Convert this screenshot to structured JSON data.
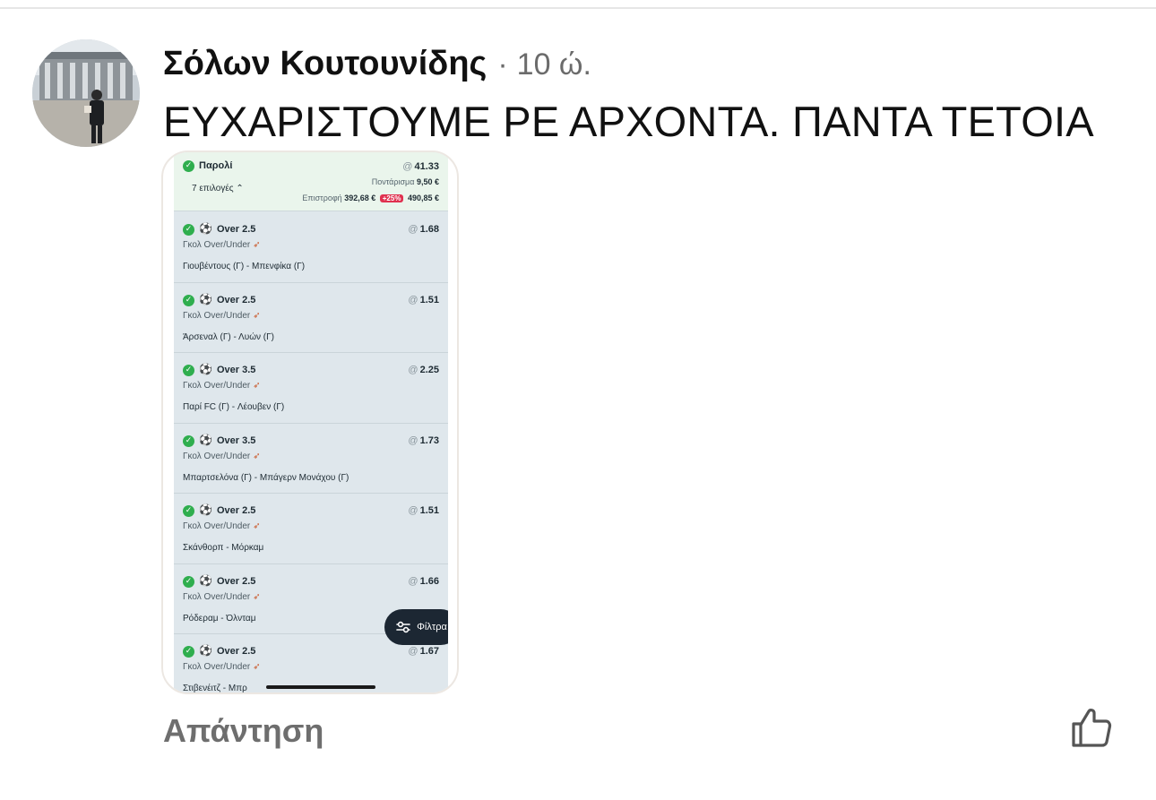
{
  "comment": {
    "author": "Σόλων Κουτουνίδης",
    "separator": "·",
    "time": "10 ώ.",
    "text": "ΕΥΧΑΡΙΣΤΟΥΜΕ ΡΕ ΑΡΧΟΝΤΑ. ΠΑΝΤΑ ΤΕΤΟΙΑ",
    "avatar_icon": "profile-photo"
  },
  "attachment": {
    "summary": {
      "bet_type": "Παρολί",
      "odds_prefix": "@",
      "total_odds": "41.33",
      "selections_label": "7 επιλογές",
      "stake_label": "Ποντάρισμα",
      "stake_value": "9,50 €",
      "return_label": "Επιστροφή",
      "return_value": "392,68 €",
      "boost_label": "+25%",
      "boosted_return": "490,85 €"
    },
    "legs": [
      {
        "pick": "Over 2.5",
        "market": "Γκολ Over/Under",
        "match": "Γιουβέντους (Γ) - Μπενφίκα (Γ)",
        "odds": "1.68"
      },
      {
        "pick": "Over 2.5",
        "market": "Γκολ Over/Under",
        "match": "Άρσεναλ (Γ) - Λυών (Γ)",
        "odds": "1.51"
      },
      {
        "pick": "Over 3.5",
        "market": "Γκολ Over/Under",
        "match": "Παρί FC (Γ) - Λέουβεν (Γ)",
        "odds": "2.25"
      },
      {
        "pick": "Over 3.5",
        "market": "Γκολ Over/Under",
        "match": "Μπαρτσελόνα (Γ) - Μπάγερν Μονάχου (Γ)",
        "odds": "1.73"
      },
      {
        "pick": "Over 2.5",
        "market": "Γκολ Over/Under",
        "match": "Σκάνθορπ - Μόρκαμ",
        "odds": "1.51"
      },
      {
        "pick": "Over 2.5",
        "market": "Γκολ Over/Under",
        "match": "Ρόδεραμ - Όλνταμ",
        "odds": "1.66"
      },
      {
        "pick": "Over 2.5",
        "market": "Γκολ Over/Under",
        "match": "Στιβενέιτζ - Μπρ",
        "odds": "1.67"
      }
    ],
    "filter_label": "Φίλτρα",
    "icons": {
      "check": "check-circle-icon",
      "ball": "soccer-ball-icon",
      "boost": "rocket-icon",
      "filter": "sliders-icon"
    }
  },
  "actions": {
    "reply_label": "Απάντηση",
    "like_icon": "thumbs-up-icon"
  },
  "colors": {
    "accent_green": "#2fae4e",
    "boost_red": "#e0314f",
    "muted_text": "#6e6e6e",
    "filter_button": "#1c2733"
  }
}
